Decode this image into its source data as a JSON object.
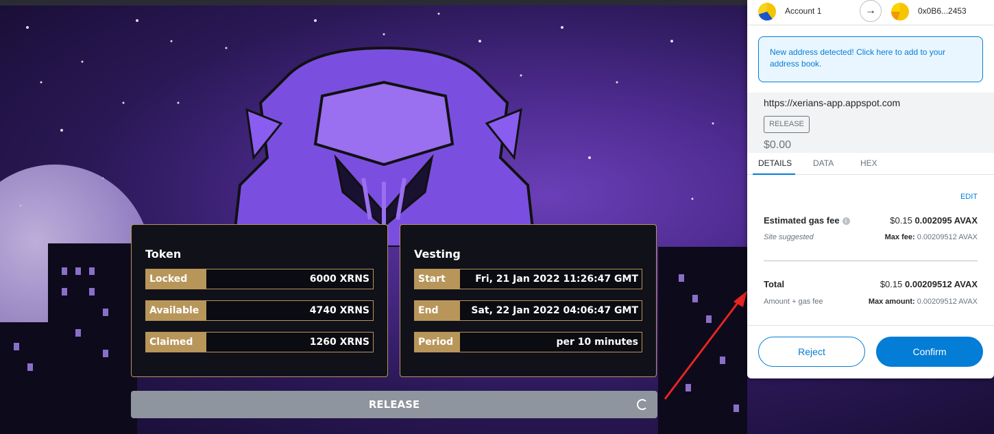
{
  "token_card": {
    "title": "Token",
    "rows": [
      {
        "label": "Locked",
        "value": "6000 XRNS"
      },
      {
        "label": "Available",
        "value": "4740 XRNS"
      },
      {
        "label": "Claimed",
        "value": "1260 XRNS"
      }
    ]
  },
  "vesting_card": {
    "title": "Vesting",
    "rows": [
      {
        "label": "Start",
        "value": "Fri, 21 Jan 2022 11:26:47 GMT"
      },
      {
        "label": "End",
        "value": "Sat, 22 Jan 2022 04:06:47 GMT"
      },
      {
        "label": "Period",
        "value": "per 10 minutes"
      }
    ]
  },
  "release_button": {
    "label": "RELEASE",
    "state": "loading"
  },
  "wallet": {
    "account_name": "Account 1",
    "to_address": "0x0B6...2453",
    "notice": "New address detected! Click here to add to your address book.",
    "origin": "https://xerians-app.appspot.com",
    "method": "RELEASE",
    "value": "$0.00",
    "tabs": [
      "DETAILS",
      "DATA",
      "HEX"
    ],
    "active_tab": "DETAILS",
    "edit_label": "EDIT",
    "gas": {
      "label": "Estimated gas fee",
      "usd": "$0.15",
      "amount": "0.002095 AVAX",
      "sub_label": "Site suggested",
      "max_label": "Max fee:",
      "max_value": "0.00209512 AVAX"
    },
    "total": {
      "label": "Total",
      "usd": "$0.15",
      "amount": "0.00209512 AVAX",
      "sub_label": "Amount + gas fee",
      "max_label": "Max amount:",
      "max_value": "0.00209512 AVAX"
    },
    "reject_label": "Reject",
    "confirm_label": "Confirm"
  },
  "colors": {
    "gold": "#b8965a",
    "card_bg": "#11111a",
    "metamask_blue": "#037dd6",
    "annotation_red": "#e8251f"
  }
}
